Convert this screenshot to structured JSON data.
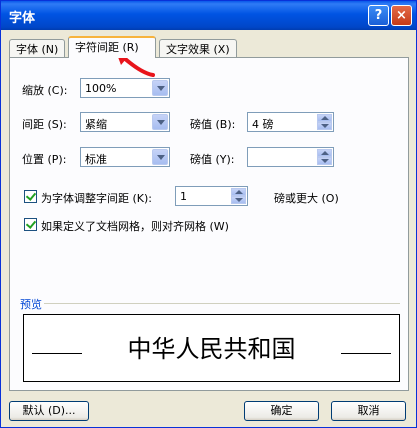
{
  "window": {
    "title": "字体",
    "help_label": "?",
    "close_label": "×"
  },
  "tabs": [
    {
      "label": "字体 (N)"
    },
    {
      "label": "字符间距 (R)"
    },
    {
      "label": "文字效果 (X)"
    }
  ],
  "form": {
    "scale_label": "缩放 (C):",
    "scale_value": "100%",
    "spacing_label": "间距 (S):",
    "spacing_value": "紧缩",
    "spacing_by_label": "磅值 (B):",
    "spacing_by_value": "4 磅",
    "position_label": "位置 (P):",
    "position_value": "标准",
    "position_by_label": "磅值 (Y):",
    "position_by_value": "",
    "kerning_label": "为字体调整字间距 (K):",
    "kerning_checked": true,
    "kerning_value": "1",
    "kerning_suffix": "磅或更大 (O)",
    "grid_label": "如果定义了文档网格，则对齐网格 (W)",
    "grid_checked": true
  },
  "preview": {
    "label": "预览",
    "text": "中华人民共和国"
  },
  "buttons": {
    "default": "默认 (D)...",
    "ok": "确定",
    "cancel": "取消"
  },
  "colors": {
    "titlebar": "#0054e3",
    "active_tab_accent": "#f7b33d",
    "annotation_arrow": "#e8141b"
  }
}
